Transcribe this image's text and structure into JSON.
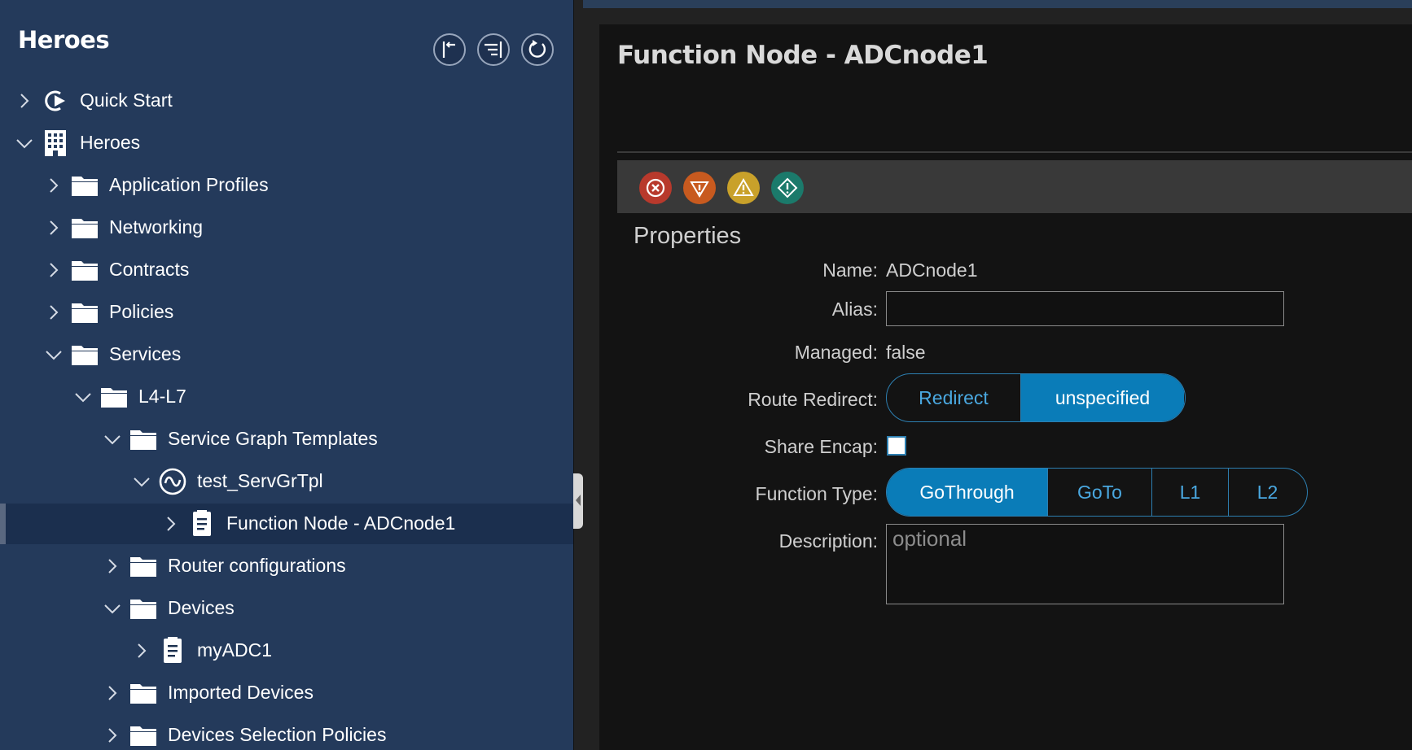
{
  "tree": {
    "title": "Heroes",
    "toolbar": {
      "collapse_icon": "collapse-all-icon",
      "expand_icon": "expand-list-icon",
      "refresh_icon": "refresh-icon"
    },
    "items": [
      {
        "label": "Quick Start",
        "icon": "quick-start-icon",
        "expanded": false,
        "level": 0
      },
      {
        "label": "Heroes",
        "icon": "tenant-building-icon",
        "expanded": true,
        "level": 0
      },
      {
        "label": "Application Profiles",
        "icon": "folder-icon",
        "expanded": false,
        "level": 1
      },
      {
        "label": "Networking",
        "icon": "folder-icon",
        "expanded": false,
        "level": 1
      },
      {
        "label": "Contracts",
        "icon": "folder-icon",
        "expanded": false,
        "level": 1
      },
      {
        "label": "Policies",
        "icon": "folder-icon",
        "expanded": false,
        "level": 1
      },
      {
        "label": "Services",
        "icon": "folder-icon",
        "expanded": true,
        "level": 1
      },
      {
        "label": "L4-L7",
        "icon": "folder-icon",
        "expanded": true,
        "level": 2
      },
      {
        "label": "Service Graph Templates",
        "icon": "folder-icon",
        "expanded": true,
        "level": 3
      },
      {
        "label": "test_ServGrTpl",
        "icon": "service-graph-icon",
        "expanded": true,
        "level": 4
      },
      {
        "label": "Function Node - ADCnode1",
        "icon": "document-icon",
        "expanded": false,
        "level": 5,
        "selected": true
      },
      {
        "label": "Router configurations",
        "icon": "folder-icon",
        "expanded": false,
        "level": 3
      },
      {
        "label": "Devices",
        "icon": "folder-icon",
        "expanded": true,
        "level": 3
      },
      {
        "label": "myADC1",
        "icon": "document-icon",
        "expanded": false,
        "level": 4
      },
      {
        "label": "Imported Devices",
        "icon": "folder-icon",
        "expanded": false,
        "level": 3
      },
      {
        "label": "Devices Selection Policies",
        "icon": "folder-icon",
        "expanded": false,
        "level": 3
      }
    ]
  },
  "page": {
    "title": "Function Node - ADCnode1",
    "faults": [
      {
        "name": "critical-fault-icon",
        "color": "#c0392b"
      },
      {
        "name": "major-fault-icon",
        "color": "#d35400"
      },
      {
        "name": "minor-fault-icon",
        "color": "#d4a017"
      },
      {
        "name": "warning-fault-icon",
        "color": "#16a085"
      }
    ],
    "properties_title": "Properties",
    "properties": {
      "name_label": "Name:",
      "name_value": "ADCnode1",
      "alias_label": "Alias:",
      "alias_value": "",
      "managed_label": "Managed:",
      "managed_value": "false",
      "route_redirect_label": "Route Redirect:",
      "route_redirect_options": [
        "Redirect",
        "unspecified"
      ],
      "route_redirect_selected": "unspecified",
      "share_encap_label": "Share Encap:",
      "share_encap_checked": false,
      "function_type_label": "Function Type:",
      "function_type_options": [
        "GoThrough",
        "GoTo",
        "L1",
        "L2"
      ],
      "function_type_selected": "GoThrough",
      "description_label": "Description:",
      "description_placeholder": "optional",
      "description_value": ""
    }
  },
  "colors": {
    "sidebar_bg": "#243a5b",
    "content_bg": "#131313",
    "accent": "#0a7cb8",
    "accent_text": "#4aa8e0"
  }
}
